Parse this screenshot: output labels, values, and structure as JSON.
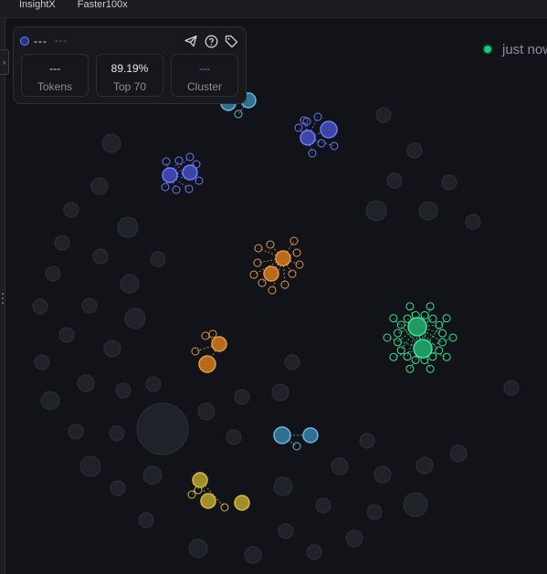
{
  "topbar": {
    "tabs": [
      "InsightX",
      "Faster100x"
    ]
  },
  "card": {
    "name": "---",
    "address": "---",
    "icons": [
      "send-icon",
      "help-icon",
      "tag-icon"
    ],
    "stats": [
      {
        "value": "---",
        "label": "Tokens"
      },
      {
        "value": "89.19%",
        "label": "Top 70"
      },
      {
        "value": "---",
        "label": "Cluster"
      }
    ]
  },
  "refresh_text": "just now",
  "colors": {
    "background": "#111318",
    "bubble_gray": "#2a2d33",
    "blue": "#3b45a8",
    "orange": "#b86a1a",
    "green": "#1f9a63",
    "teal": "#2f6f8f",
    "yellow": "#a38c2a",
    "live": "#1fc77f"
  }
}
